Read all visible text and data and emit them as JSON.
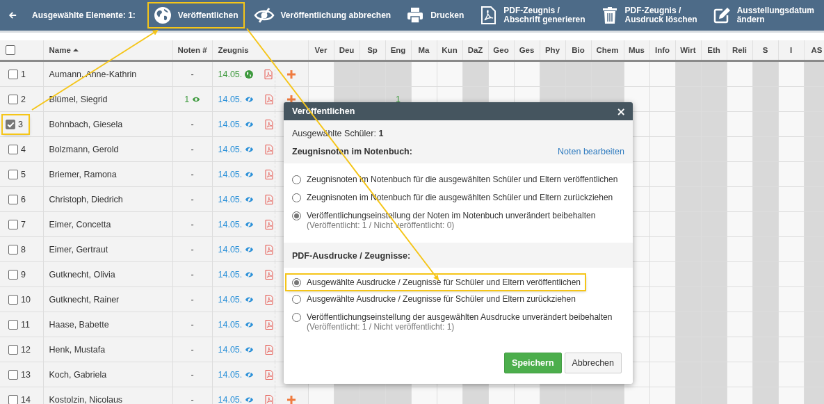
{
  "toolbar": {
    "selection_label": "Ausgewählte Elemente: 1:",
    "actions": [
      {
        "kind": "publish",
        "lines": [
          "Veröffentlichen"
        ],
        "highlighted": true
      },
      {
        "kind": "unpublish",
        "lines": [
          "Veröffentlichung abbrechen"
        ],
        "highlighted": false
      },
      {
        "kind": "print",
        "lines": [
          "Drucken"
        ],
        "highlighted": false
      },
      {
        "kind": "generate",
        "lines": [
          "PDF-Zeugnis /",
          "Abschrift generieren"
        ],
        "highlighted": false
      },
      {
        "kind": "delete",
        "lines": [
          "PDF-Zeugnis /",
          "Ausdruck löschen"
        ],
        "highlighted": false
      },
      {
        "kind": "edit-date",
        "lines": [
          "Ausstellungsdatum",
          "ändern"
        ],
        "highlighted": false
      }
    ]
  },
  "table": {
    "all_checked": false,
    "columns": {
      "name": "Name",
      "grades": "Noten #",
      "report": "Zeugnis"
    },
    "subjects": [
      {
        "label": "Ver",
        "shaded": false
      },
      {
        "label": "Deu",
        "shaded": true
      },
      {
        "label": "Sp",
        "shaded": true
      },
      {
        "label": "Eng",
        "shaded": true
      },
      {
        "label": "Ma",
        "shaded": false
      },
      {
        "label": "Kun",
        "shaded": false
      },
      {
        "label": "DaZ",
        "shaded": true
      },
      {
        "label": "Geo",
        "shaded": false
      },
      {
        "label": "Ges",
        "shaded": false
      },
      {
        "label": "Phy",
        "shaded": true
      },
      {
        "label": "Bio",
        "shaded": true
      },
      {
        "label": "Chem",
        "shaded": true
      },
      {
        "label": "Mus",
        "shaded": false
      },
      {
        "label": "Info",
        "shaded": false
      },
      {
        "label": "Wirt",
        "shaded": true
      },
      {
        "label": "Eth",
        "shaded": true
      },
      {
        "label": "Reli",
        "shaded": false
      },
      {
        "label": "S",
        "shaded": true
      },
      {
        "label": "I",
        "shaded": false
      },
      {
        "label": "AS",
        "shaded": true
      }
    ],
    "rows": [
      {
        "number": "1",
        "checked": false,
        "highlighted": false,
        "name": "Aumann, Anne-Kathrin",
        "grades": "-",
        "date": "14.05.",
        "published": true
      },
      {
        "number": "2",
        "checked": false,
        "highlighted": false,
        "name": "Blümel, Siegrid",
        "grades": "1",
        "grades_visible": true,
        "date": "14.05.",
        "published": false,
        "subject_grades": {
          "3": "1"
        }
      },
      {
        "number": "3",
        "checked": true,
        "highlighted": true,
        "name": "Bohnbach, Giesela",
        "grades": "-",
        "date": "14.05.",
        "published": false
      },
      {
        "number": "4",
        "checked": false,
        "highlighted": false,
        "name": "Bolzmann, Gerold",
        "grades": "-",
        "date": "14.05.",
        "published": false
      },
      {
        "number": "5",
        "checked": false,
        "highlighted": false,
        "name": "Briemer, Ramona",
        "grades": "-",
        "date": "14.05.",
        "published": false
      },
      {
        "number": "6",
        "checked": false,
        "highlighted": false,
        "name": "Christoph, Diedrich",
        "grades": "-",
        "date": "14.05.",
        "published": false
      },
      {
        "number": "7",
        "checked": false,
        "highlighted": false,
        "name": "Eimer, Concetta",
        "grades": "-",
        "date": "14.05.",
        "published": false
      },
      {
        "number": "8",
        "checked": false,
        "highlighted": false,
        "name": "Eimer, Gertraut",
        "grades": "-",
        "date": "14.05.",
        "published": false
      },
      {
        "number": "9",
        "checked": false,
        "highlighted": false,
        "name": "Gutknecht, Olivia",
        "grades": "-",
        "date": "14.05.",
        "published": false
      },
      {
        "number": "10",
        "checked": false,
        "highlighted": false,
        "name": "Gutknecht, Rainer",
        "grades": "-",
        "date": "14.05.",
        "published": false
      },
      {
        "number": "11",
        "checked": false,
        "highlighted": false,
        "name": "Haase, Babette",
        "grades": "-",
        "date": "14.05.",
        "published": false
      },
      {
        "number": "12",
        "checked": false,
        "highlighted": false,
        "name": "Henk, Mustafa",
        "grades": "-",
        "date": "14.05.",
        "published": false
      },
      {
        "number": "13",
        "checked": false,
        "highlighted": false,
        "name": "Koch, Gabriela",
        "grades": "-",
        "date": "14.05.",
        "published": false
      },
      {
        "number": "14",
        "checked": false,
        "highlighted": false,
        "name": "Kostolzin, Nicolaus",
        "grades": "-",
        "date": "14.05.",
        "published": false
      }
    ]
  },
  "dialog": {
    "title": "Veröffentlichen",
    "close": "×",
    "selected_label": "Ausgewählte Schüler: **1**",
    "sections": [
      {
        "heading": "Zeugnisnoten im Notenbuch:",
        "link": "Noten bearbeiten",
        "options": [
          {
            "label": "Zeugnisnoten im Notenbuch für die ausgewählten Schüler und Eltern veröffentlichen",
            "selected": false,
            "highlighted": false
          },
          {
            "label": "Zeugnisnoten im Notenbuch für die ausgewählten Schüler und Eltern zurückziehen",
            "selected": false,
            "highlighted": false
          },
          {
            "label": "Veröffentlichungseinstellung der Noten im Notenbuch unverändert beibehalten",
            "note": "(Veröffentlicht: 1 / Nicht veröffentlicht: 0)",
            "selected": true,
            "highlighted": false
          }
        ]
      },
      {
        "heading": "PDF-Ausdrucke / Zeugnisse:",
        "options": [
          {
            "label": "Ausgewählte Ausdrucke / Zeugnisse für Schüler und Eltern veröffentlichen",
            "selected": true,
            "highlighted": true
          },
          {
            "label": "Ausgewählte Ausdrucke / Zeugnisse für Schüler und Eltern zurückziehen",
            "selected": false,
            "highlighted": false
          },
          {
            "label": "Veröffentlichungseinstellung der ausgewählten Ausdrucke unverändert beibehalten",
            "note": "(Veröffentlicht: 1 / Nicht veröffentlicht: 1)",
            "selected": false,
            "highlighted": false
          }
        ]
      }
    ],
    "buttons": [
      {
        "kind": "primary",
        "label": "Speichern"
      },
      {
        "kind": "secondary",
        "label": "Abbrechen"
      }
    ]
  }
}
